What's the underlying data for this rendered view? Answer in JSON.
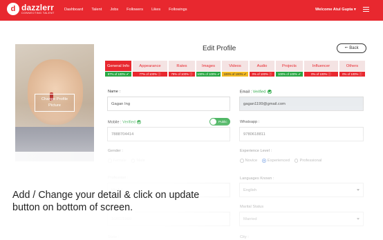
{
  "brand": {
    "mark": "d",
    "name": "dazzlerr",
    "tagline": "CONNECTING TALENT"
  },
  "nav": [
    "Dashboard",
    "Talent",
    "Jobs",
    "Followers",
    "Likes",
    "Followings"
  ],
  "welcome": "Welcome Atul Gupta",
  "profile_photo": {
    "button_label": "Change Profile Picture"
  },
  "page_title": "Edit Profile",
  "back_button": "Back",
  "tabs": [
    {
      "label": "General Info",
      "progress": "97% of 100%",
      "status": "green",
      "active": true
    },
    {
      "label": "Appearance",
      "progress": "77% of 100%",
      "status": "red"
    },
    {
      "label": "Rates",
      "progress": "78% of 100%",
      "status": "red"
    },
    {
      "label": "Images",
      "progress": "100% of 100%",
      "status": "green"
    },
    {
      "label": "Videos",
      "progress": "100% of 100%",
      "status": "yellow"
    },
    {
      "label": "Audio",
      "progress": "0% of 100%",
      "status": "red"
    },
    {
      "label": "Projects",
      "progress": "100% of 100%",
      "status": "green"
    },
    {
      "label": "Influencer",
      "progress": "0% of 100%",
      "status": "red"
    },
    {
      "label": "Others",
      "progress": "0% of 100%",
      "status": "red"
    }
  ],
  "form": {
    "name": {
      "label": "Name :",
      "value": "Gagan Ing"
    },
    "email": {
      "label": "Email :",
      "verified": "Verified",
      "value": "gagan1199@gmail.com"
    },
    "mobile": {
      "label": "Mobile :",
      "verified": "Verified",
      "value": "7888704414",
      "toggle": "Public"
    },
    "whatsapp": {
      "label": "Whatsapp :",
      "value": "9780618811"
    },
    "gender": {
      "label": "Gender :",
      "options": [
        "Female",
        "Male"
      ]
    },
    "experience": {
      "label": "Experience Level :",
      "options": [
        "Novice",
        "Experienced",
        "Professional"
      ],
      "selected": "Experienced"
    },
    "profession": {
      "label": "Profession :",
      "value": "Model"
    },
    "languages": {
      "label": "Languages Known :",
      "value": "English"
    },
    "dob": {
      "label": "Date of Birth :",
      "value": "10/01/1999"
    },
    "marital": {
      "label": "Marital Status",
      "value": "Married"
    },
    "state": {
      "label": "State :"
    },
    "city": {
      "label": "City :"
    }
  },
  "instruction": "Add / Change your detail & click on update button on bottom of screen."
}
